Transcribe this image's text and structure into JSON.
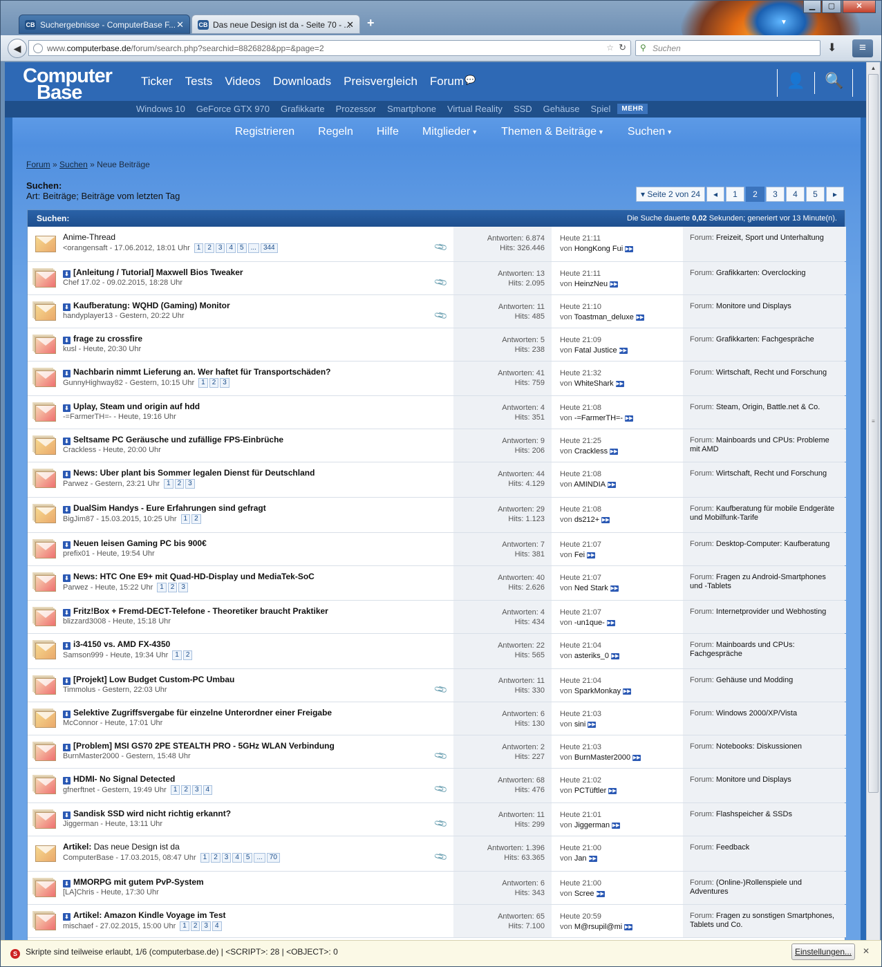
{
  "browser": {
    "tabs": [
      {
        "label": "Suchergebnisse - ComputerBase F...",
        "active": true
      },
      {
        "label": "Das neue Design ist da - Seite 70 - ...",
        "active": false
      }
    ],
    "url_prefix": "www.",
    "url_domain": "computerbase.de",
    "url_path": "/forum/search.php?searchid=8826828&pp=&page=2",
    "search_placeholder": "Suchen",
    "colors": {
      "chrome": "#6f90b4",
      "page_bg": "#2a6bb8",
      "accent": "#3b74bd"
    }
  },
  "site": {
    "logo_line1": "Computer",
    "logo_line2": "Base",
    "main_nav": [
      "Ticker",
      "Tests",
      "Videos",
      "Downloads",
      "Preisvergleich",
      "Forum"
    ],
    "sub_nav": [
      "Windows 10",
      "GeForce GTX 970",
      "Grafikkarte",
      "Prozessor",
      "Smartphone",
      "Virtual Reality",
      "SSD",
      "Gehäuse",
      "Spiel"
    ],
    "sub_nav_more": "MEHR",
    "forum_nav": [
      "Registrieren",
      "Regeln",
      "Hilfe",
      "Mitglieder",
      "Themen & Beiträge",
      "Suchen"
    ]
  },
  "breadcrumb": {
    "forum": "Forum",
    "search": "Suchen",
    "current": "Neue Beiträge",
    "sep": "»"
  },
  "heading": {
    "title": "Suchen:",
    "subtitle": "Art: Beiträge; Beiträge vom letzten Tag"
  },
  "pager": {
    "label": "Seite 2 von 24",
    "pages": [
      "1",
      "2",
      "3",
      "4",
      "5"
    ],
    "current": "2"
  },
  "results": {
    "header_title": "Suchen:",
    "header_info_pre": "Die Suche dauerte",
    "header_info_time": "0,02",
    "header_info_post": "Sekunden; generiert vor 13 Minute(n).",
    "answers_label": "Antworten:",
    "hits_label": "Hits:",
    "by_label": "von",
    "forum_label": "Forum:",
    "rows": [
      {
        "title": "Anime-Thread",
        "prefix": "",
        "plain": true,
        "starter": "<orangensaft - 17.06.2012, 18:01 Uhr",
        "pages": [
          "1",
          "2",
          "3",
          "4",
          "5",
          "...",
          "344"
        ],
        "answers": "6.874",
        "hits": "326.446",
        "time": "Heute 21:11",
        "user": "HongKong Fui",
        "forum": "Freizeit, Sport und Unterhaltung",
        "attach": true
      },
      {
        "title": "[Anleitung / Tutorial] Maxwell Bios Tweaker",
        "starter": "Chef 17.02 - 09.02.2015, 18:28 Uhr",
        "pages": [],
        "answers": "13",
        "hits": "2.095",
        "time": "Heute 21:11",
        "user": "HeinzNeu",
        "forum": "Grafikkarten: Overclocking",
        "attach": true
      },
      {
        "title": "Kaufberatung: WQHD (Gaming) Monitor",
        "starter": "handyplayer13 - Gestern, 20:22 Uhr",
        "pages": [],
        "answers": "11",
        "hits": "485",
        "time": "Heute 21:10",
        "user": "Toastman_deluxe",
        "forum": "Monitore und Displays",
        "attach": true
      },
      {
        "title": "frage zu crossfire",
        "starter": "kusl - Heute, 20:30 Uhr",
        "pages": [],
        "answers": "5",
        "hits": "238",
        "time": "Heute 21:09",
        "user": "Fatal Justice",
        "forum": "Grafikkarten: Fachgespräche",
        "attach": false
      },
      {
        "title": "Nachbarin nimmt Lieferung an. Wer haftet für Transportschäden?",
        "starter": "GunnyHighway82 - Gestern, 10:15 Uhr",
        "pages": [
          "1",
          "2",
          "3"
        ],
        "answers": "41",
        "hits": "759",
        "time": "Heute 21:32",
        "user": "WhiteShark",
        "forum": "Wirtschaft, Recht und Forschung",
        "attach": false
      },
      {
        "title": "Uplay, Steam und origin auf hdd",
        "starter": "-=FarmerTH=- - Heute, 19:16 Uhr",
        "pages": [],
        "answers": "4",
        "hits": "351",
        "time": "Heute 21:08",
        "user": "-=FarmerTH=-",
        "forum": "Steam, Origin, Battle.net & Co.",
        "attach": false
      },
      {
        "title": "Seltsame PC Geräusche und zufällige FPS-Einbrüche",
        "starter": "Crackless - Heute, 20:00 Uhr",
        "pages": [],
        "answers": "9",
        "hits": "206",
        "time": "Heute 21:25",
        "user": "Crackless",
        "forum": "Mainboards und CPUs: Probleme mit AMD",
        "attach": false
      },
      {
        "title": "News: Uber plant bis Sommer legalen Dienst für Deutschland",
        "starter": "Parwez - Gestern, 23:21 Uhr",
        "pages": [
          "1",
          "2",
          "3"
        ],
        "answers": "44",
        "hits": "4.129",
        "time": "Heute 21:08",
        "user": "AMINDIA",
        "forum": "Wirtschaft, Recht und Forschung",
        "attach": false
      },
      {
        "title": "DualSim Handys - Eure Erfahrungen sind gefragt",
        "starter": "BigJim87 - 15.03.2015, 10:25 Uhr",
        "pages": [
          "1",
          "2"
        ],
        "answers": "29",
        "hits": "1.123",
        "time": "Heute 21:08",
        "user": "ds212+",
        "forum": "Kaufberatung für mobile Endgeräte und Mobilfunk-Tarife",
        "attach": false
      },
      {
        "title": "Neuen leisen Gaming PC bis 900€",
        "starter": "prefix01 - Heute, 19:54 Uhr",
        "pages": [],
        "answers": "7",
        "hits": "381",
        "time": "Heute 21:07",
        "user": "Fei",
        "forum": "Desktop-Computer: Kaufberatung",
        "attach": false
      },
      {
        "title": "News: HTC One E9+ mit Quad-HD-Display und MediaTek-SoC",
        "starter": "Parwez - Heute, 15:22 Uhr",
        "pages": [
          "1",
          "2",
          "3"
        ],
        "answers": "40",
        "hits": "2.626",
        "time": "Heute 21:07",
        "user": "Ned Stark",
        "forum": "Fragen zu Android-Smartphones und -Tablets",
        "attach": false
      },
      {
        "title": "Fritz!Box + Fremd-DECT-Telefone - Theoretiker braucht Praktiker",
        "starter": "blizzard3008 - Heute, 15:18 Uhr",
        "pages": [],
        "answers": "4",
        "hits": "434",
        "time": "Heute 21:07",
        "user": "-un1que-",
        "forum": "Internetprovider und Webhosting",
        "attach": false
      },
      {
        "title": "i3-4150 vs. AMD FX-4350",
        "starter": "Samson999 - Heute, 19:34 Uhr",
        "pages": [
          "1",
          "2"
        ],
        "answers": "22",
        "hits": "565",
        "time": "Heute 21:04",
        "user": "asteriks_0",
        "forum": "Mainboards und CPUs: Fachgespräche",
        "attach": false
      },
      {
        "title": "[Projekt] Low Budget Custom-PC Umbau",
        "starter": "Timmolus - Gestern, 22:03 Uhr",
        "pages": [],
        "answers": "11",
        "hits": "330",
        "time": "Heute 21:04",
        "user": "SparkMonkay",
        "forum": "Gehäuse und Modding",
        "attach": true
      },
      {
        "title": "Selektive Zugriffsvergabe für einzelne Unterordner einer Freigabe",
        "starter": "McConnor - Heute, 17:01 Uhr",
        "pages": [],
        "answers": "6",
        "hits": "130",
        "time": "Heute 21:03",
        "user": "sini",
        "forum": "Windows 2000/XP/Vista",
        "attach": false
      },
      {
        "title": "[Problem] MSI GS70 2PE STEALTH PRO - 5GHz WLAN Verbindung",
        "starter": "BurnMaster2000 - Gestern, 15:48 Uhr",
        "pages": [],
        "answers": "2",
        "hits": "227",
        "time": "Heute 21:03",
        "user": "BurnMaster2000",
        "forum": "Notebooks: Diskussionen",
        "attach": true
      },
      {
        "title": "HDMI- No Signal Detected",
        "starter": "gfnerftnet - Gestern, 19:49 Uhr",
        "pages": [
          "1",
          "2",
          "3",
          "4"
        ],
        "answers": "68",
        "hits": "476",
        "time": "Heute 21:02",
        "user": "PCTüftler",
        "forum": "Monitore und Displays",
        "attach": true
      },
      {
        "title": "Sandisk SSD wird nicht richtig erkannt?",
        "starter": "Jiggerman - Heute, 13:11 Uhr",
        "pages": [],
        "answers": "11",
        "hits": "299",
        "time": "Heute 21:01",
        "user": "Jiggerman",
        "forum": "Flashspeicher & SSDs",
        "attach": true
      },
      {
        "title": "Das neue Design ist da",
        "prefix": "Artikel:",
        "plain": true,
        "starter": "ComputerBase - 17.03.2015, 08:47 Uhr",
        "pages": [
          "1",
          "2",
          "3",
          "4",
          "5",
          "...",
          "70"
        ],
        "answers": "1.396",
        "hits": "63.365",
        "time": "Heute 21:00",
        "user": "Jan",
        "forum": "Feedback",
        "attach": true
      },
      {
        "title": "MMORPG mit gutem PvP-System",
        "starter": "[LA]Chris - Heute, 17:30 Uhr",
        "pages": [],
        "answers": "6",
        "hits": "343",
        "time": "Heute 21:00",
        "user": "Scree",
        "forum": "(Online-)Rollenspiele und Adventures",
        "attach": false
      },
      {
        "title": "Artikel: Amazon Kindle Voyage im Test",
        "starter": "mischaef - 27.02.2015, 15:00 Uhr",
        "pages": [
          "1",
          "2",
          "3",
          "4"
        ],
        "answers": "65",
        "hits": "7.100",
        "time": "Heute 20:59",
        "user": "M@rsupil@mi",
        "forum": "Fragen zu sonstigen Smartphones, Tablets und Co.",
        "attach": false
      }
    ]
  },
  "statusbar": {
    "text": "Skripte sind teilweise erlaubt, 1/6 (computerbase.de) | <SCRIPT>: 28 | <OBJECT>: 0",
    "button": "Einstellungen..."
  }
}
